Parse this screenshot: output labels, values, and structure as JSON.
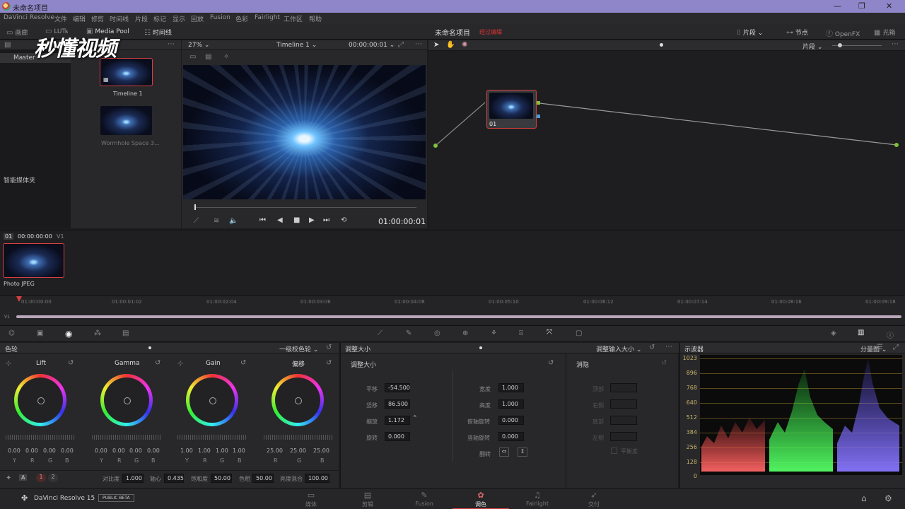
{
  "window": {
    "title": "未命名项目"
  },
  "window_controls": {
    "minimize": "—",
    "restore": "❐",
    "close": "✕"
  },
  "menu": [
    "DaVinci Resolve",
    "文件",
    "编辑",
    "修剪",
    "时间线",
    "片段",
    "标记",
    "显示",
    "回放",
    "Fusion",
    "色彩",
    "Fairlight",
    "工作区",
    "帮助"
  ],
  "toolbar": {
    "gallery": "画廊",
    "luts": "LUTs",
    "media_pool": "Media Pool",
    "timeline": "时间线",
    "project_name": "未命名项目",
    "edited_status": "经过编辑",
    "clip_mode": "片段",
    "nodes": "节点",
    "openfx": "OpenFX",
    "lightbox": "光箱"
  },
  "watermark": "秒懂视频",
  "media_pool": {
    "master": "Master",
    "smart_bins": "智能媒体夹",
    "clips": [
      {
        "name": "Timeline 1"
      },
      {
        "name": "Wormhole Space 3..."
      }
    ]
  },
  "viewer": {
    "zoom": "27%",
    "timeline_name": "Timeline 1",
    "timecode_top": "00:00:00:01",
    "timecode": "01:00:00:01"
  },
  "node_editor": {
    "mode": "片段",
    "node_label": "01"
  },
  "clip_strip": {
    "index": "01",
    "timecode": "00:00:00:00",
    "track": "V1",
    "clip_type": "Photo JPEG"
  },
  "timeline": {
    "track_label": "V1",
    "ticks": [
      "01:00:00:00",
      "01:00:01:02",
      "01:00:02:04",
      "01:00:03:06",
      "01:00:04:08",
      "01:00:05:10",
      "01:00:06:12",
      "01:00:07:14",
      "01:00:08:16",
      "01:00:09:18"
    ]
  },
  "color_wheels": {
    "title": "色轮",
    "mode": "一级校色轮",
    "wheels": [
      {
        "name": "Lift",
        "values": [
          "0.00",
          "0.00",
          "0.00",
          "0.00"
        ],
        "channels": [
          "Y",
          "R",
          "G",
          "B"
        ]
      },
      {
        "name": "Gamma",
        "values": [
          "0.00",
          "0.00",
          "0.00",
          "0.00"
        ],
        "channels": [
          "Y",
          "R",
          "G",
          "B"
        ]
      },
      {
        "name": "Gain",
        "values": [
          "1.00",
          "1.00",
          "1.00",
          "1.00"
        ],
        "channels": [
          "Y",
          "R",
          "G",
          "B"
        ]
      },
      {
        "name": "偏移",
        "values": [
          "25.00",
          "25.00",
          "25.00"
        ],
        "channels": [
          "R",
          "G",
          "B"
        ]
      }
    ],
    "footer": {
      "page1": "1",
      "page2": "2",
      "contrast_label": "对比度",
      "contrast": "1.000",
      "pivot_label": "轴心",
      "pivot": "0.435",
      "saturation_label": "饱和度",
      "saturation": "50.00",
      "hue_label": "色相",
      "hue": "50.00",
      "lum_mix_label": "亮度混合",
      "lum_mix": "100.00"
    }
  },
  "sizing": {
    "title": "调整大小",
    "mode": "调整输入大小",
    "section": "调整大小",
    "pan_label": "平移",
    "pan": "-54.500",
    "tilt_label": "竖移",
    "tilt": "86.500",
    "zoom_label": "缩放",
    "zoom": "1.172",
    "rotate_label": "旋转",
    "rotate": "0.000",
    "width_label": "宽度",
    "width": "1.000",
    "height_label": "高度",
    "height": "1.000",
    "pitch_label": "俯轴旋转",
    "pitch": "0.000",
    "yaw_label": "竖轴旋转",
    "yaw": "0.000",
    "flip_label": "翻转",
    "blanking": "消隐",
    "blank_top": "顶部",
    "blank_right": "右侧",
    "blank_bottom": "底部",
    "blank_left": "左侧",
    "blank_balance": "平衡度"
  },
  "scope": {
    "title": "示波器",
    "mode": "分量图",
    "scale": [
      "1023",
      "896",
      "768",
      "640",
      "512",
      "384",
      "256",
      "128",
      "0"
    ]
  },
  "bottom": {
    "app_name": "DaVinci Resolve 15",
    "beta": "PUBLIC BETA",
    "pages": [
      {
        "label": "媒体",
        "icon": "▭"
      },
      {
        "label": "剪辑",
        "icon": "▤"
      },
      {
        "label": "Fusion",
        "icon": "✎"
      },
      {
        "label": "调色",
        "icon": "✿"
      },
      {
        "label": "Fairlight",
        "icon": "♫"
      },
      {
        "label": "交付",
        "icon": "➶"
      }
    ],
    "home_icon": "⌂",
    "settings_icon": "⚙"
  },
  "colors": {
    "accent": "#d84040",
    "title_bar": "#8f86c9",
    "scope_red": "#ff5555",
    "scope_green": "#44ff55",
    "scope_blue": "#6655ff"
  }
}
